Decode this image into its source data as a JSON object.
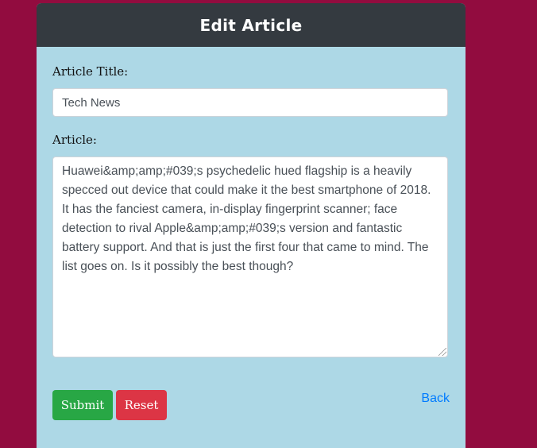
{
  "header": {
    "title": "Edit Article"
  },
  "form": {
    "title_label": "Article Title:",
    "title_value": "Tech News",
    "article_label": "Article:",
    "article_value": "Huawei&amp;amp;#039;s psychedelic hued flagship is a heavily specced out device that could make it the best smartphone of 2018. It has the fanciest camera, in-display fingerprint scanner; face detection to rival Apple&amp;amp;#039;s version and fantastic battery support. And that is just the first four that came to mind. The list goes on. Is it possibly the best though?",
    "submit_label": "Submit",
    "reset_label": "Reset",
    "back_label": "Back"
  },
  "colors": {
    "background": "#920c3f",
    "card": "#add8e6",
    "header": "#343a40",
    "submit": "#28a745",
    "reset": "#dc3545",
    "link": "#007bff"
  }
}
